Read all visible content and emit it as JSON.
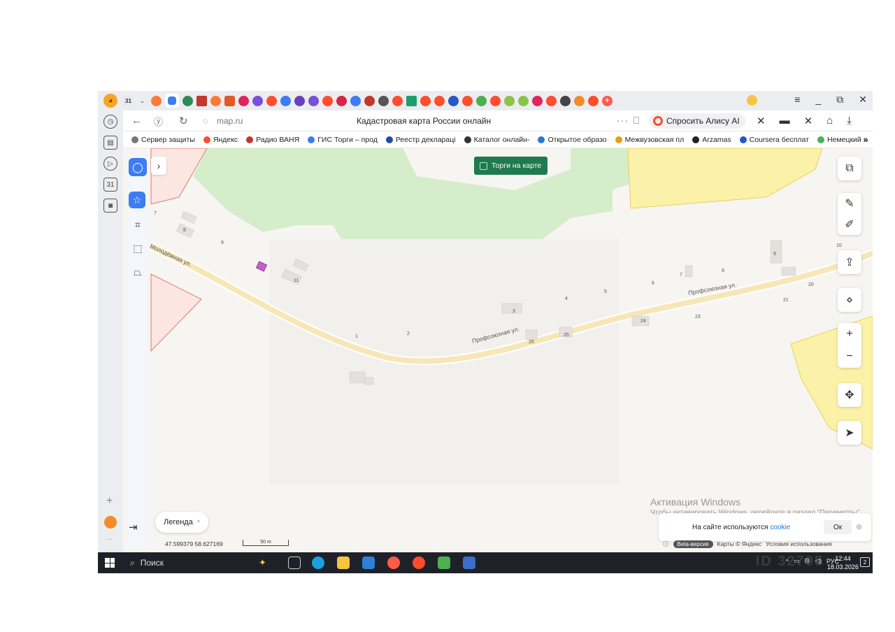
{
  "browser": {
    "url": "map.ru",
    "page_title": "Кадастровая карта России онлайн",
    "more": "···",
    "alice_label": "Спросить Алису AI",
    "tab_badge": "31",
    "bookmarks": [
      {
        "label": "Сервер защиты",
        "color": "#777777"
      },
      {
        "label": "Яндекс",
        "color": "#ff4d2d"
      },
      {
        "label": "Радио ВАНЯ",
        "color": "#c0392b"
      },
      {
        "label": "ГИС Торги – прод",
        "color": "#3d7cf2"
      },
      {
        "label": "Реестр деклараці",
        "color": "#1f4e9c"
      },
      {
        "label": "Каталог онлайн-",
        "color": "#333333"
      },
      {
        "label": "Открытое образо",
        "color": "#2a78d4"
      },
      {
        "label": "Межвузовская пл",
        "color": "#e0a020"
      },
      {
        "label": "Arzamas",
        "color": "#222222"
      },
      {
        "label": "Coursera бесплат",
        "color": "#2a56c6"
      },
      {
        "label": "Немецкий я",
        "color": "#4caf50"
      }
    ],
    "bookmarks_more": "»",
    "window_controls": [
      "≡",
      "_",
      "⧉",
      "✕"
    ]
  },
  "map": {
    "torgi_label": "Торги на карте",
    "streets": [
      {
        "label": "Молодёжная ул."
      },
      {
        "label": "Профсоюзная ул."
      },
      {
        "label": "Профсоюзная ул."
      }
    ],
    "buildings": [
      "7",
      "8",
      "9",
      "11",
      "1",
      "2",
      "3",
      "4",
      "5",
      "6",
      "7",
      "8",
      "9",
      "10",
      "20",
      "21",
      "23",
      "24",
      "25",
      "26"
    ],
    "legend_label": "Легенда",
    "legend_chevron": "^",
    "coords": "47.599379  58.627169",
    "scale_label": "50 m",
    "cookie_text": "На сайте используются",
    "cookie_link": "cookie",
    "cookie_ok": "Ок",
    "activation_title": "Активация Windows",
    "activation_text": "Чтобы активировать Windows, перейдите в раздел \"Параметры\".",
    "beta_label": "Beta-версия",
    "attrib_maps": "Карты © Яндекс",
    "attrib_terms": "Условия использования"
  },
  "taskbar": {
    "search_label": "Поиск",
    "lang": "РУС",
    "time": "12:44",
    "date": "18.03.2026",
    "notif_count": "2",
    "watermark": "ID 32795"
  },
  "colors": {
    "accent_blue": "#3d7cf2",
    "torgi_green": "#1f7a4f",
    "forest_green": "#d6edcc",
    "plot_yellow": "#fbf1a8",
    "plot_red_outline": "#e07a6a"
  }
}
